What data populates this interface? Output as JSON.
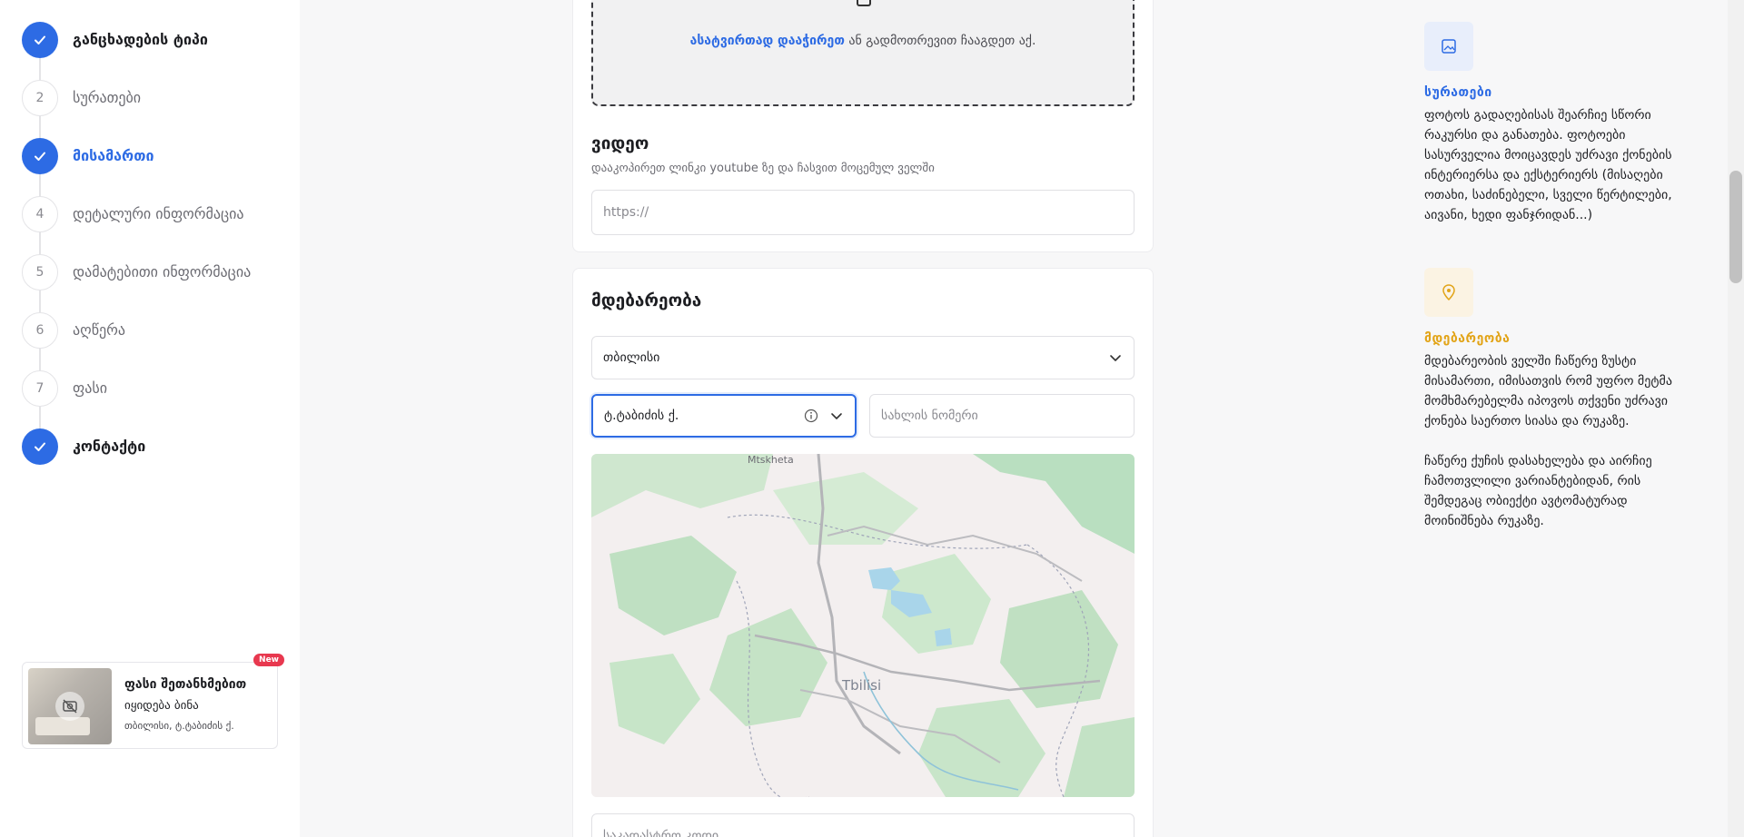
{
  "steps": [
    {
      "number": "1",
      "label": "განცხადების ტიპი",
      "state": "done"
    },
    {
      "number": "2",
      "label": "სურათები",
      "state": "todo"
    },
    {
      "number": "3",
      "label": "მისამართი",
      "state": "active"
    },
    {
      "number": "4",
      "label": "დეტალური ინფორმაცია",
      "state": "todo"
    },
    {
      "number": "5",
      "label": "დამატებითი ინფორმაცია",
      "state": "todo"
    },
    {
      "number": "6",
      "label": "აღწერა",
      "state": "todo"
    },
    {
      "number": "7",
      "label": "ფასი",
      "state": "todo"
    },
    {
      "number": "8",
      "label": "კონტაქტი",
      "state": "done"
    }
  ],
  "summary": {
    "title": "ფასი შეთანხმებით",
    "subtitle": "იყიდება ბინა",
    "address": "თბილისი, ტ.ტაბიძის ქ.",
    "badge": "New"
  },
  "upload": {
    "link_text": "ასატვირთად დააჭირეთ",
    "rest_text": " ან გადმოთრევით ჩააგდეთ აქ."
  },
  "video": {
    "title": "ვიდეო",
    "hint": "დააკოპირეთ ლინკი youtube ზე და ჩასვით მოცემულ ველში",
    "placeholder": "https://"
  },
  "location": {
    "title": "მდებარეობა",
    "city_value": "თბილისი",
    "street_value": "ტ.ტაბიძის ქ.",
    "house_placeholder": "სახლის ნომერი",
    "cadastral_placeholder": "საკადასტრო კოდი",
    "map_label_top": "Mtskheta",
    "map_label_city": "Tbilisi"
  },
  "info": {
    "photos": {
      "title": "სურათები",
      "text": "ფოტოს გადაღებისას შეარჩიე სწორი რაკურსი და განათება. ფოტოები სასურველია მოიცავდეს უძრავი ქონების ინტერიერსა და ექსტერიერს (მისაღები ოთახი, საძინებელი, სველი წერტილები, აივანი, ხედი ფანჯრიდან...)"
    },
    "location": {
      "title": "მდებარეობა",
      "text": "მდებარეობის ველში ჩაწერე ზუსტი მისამართი, იმისათვის რომ უფრო მეტმა მომხმარებელმა იპოვოს თქვენი უძრავი ქონება საერთო სიასა და რუკაზე.\n\nჩაწერე ქუჩის დასახელება და აირჩიე ჩამოთვლილი ვარიანტებიდან, რის შემდეგაც ობიექტი ავტომატურად მოინიშნება რუკაზე."
    }
  },
  "colors": {
    "accent": "#2d6be4",
    "photo_icon_bg": "#e8eefb",
    "location_icon_bg": "#fbf3e3",
    "location_accent": "#e2a418"
  },
  "icons": {
    "check": "check-icon",
    "chevron": "chevron-down-icon",
    "info": "info-icon",
    "image": "image-icon",
    "pin": "map-pin-icon"
  }
}
